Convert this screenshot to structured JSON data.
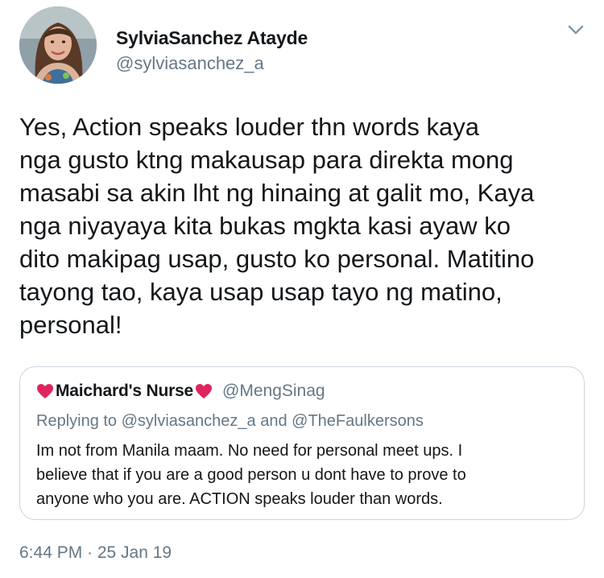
{
  "tweet": {
    "author": {
      "display_name": "SylviaSanchez Atayde",
      "handle": "@sylviasanchez_a",
      "avatar": "profile-photo"
    },
    "menu_icon": "chevron-down-icon",
    "text": "Yes, Action speaks louder thn  words kaya\nnga gusto ktng  makausap para direkta mong\nmasabi sa akin lht ng hinaing at galit mo, Kaya\nnga niyayaya kita bukas mgkta kasi ayaw ko\ndito makipag usap, gusto ko personal. Matitino\ntayong tao, kaya usap usap tayo ng matino,\npersonal!",
    "timestamp": "6:44 PM · 25 Jan 19"
  },
  "quoted_tweet": {
    "display_name": "Maichard's Nurse",
    "name_icons": [
      "heart-icon",
      "heart-icon"
    ],
    "heart_color": "#e0245e",
    "handle": "@MengSinag",
    "replying_to": "Replying to @sylviasanchez_a and @TheFaulkersons",
    "text": "Im not from Manila maam. No need for personal meet ups. I\nbelieve that if you are a good person u dont have to prove to\nanyone who you are. ACTION speaks louder than words."
  },
  "colors": {
    "text_primary": "#14171a",
    "text_secondary": "#657786",
    "border": "#ccd6dd"
  }
}
